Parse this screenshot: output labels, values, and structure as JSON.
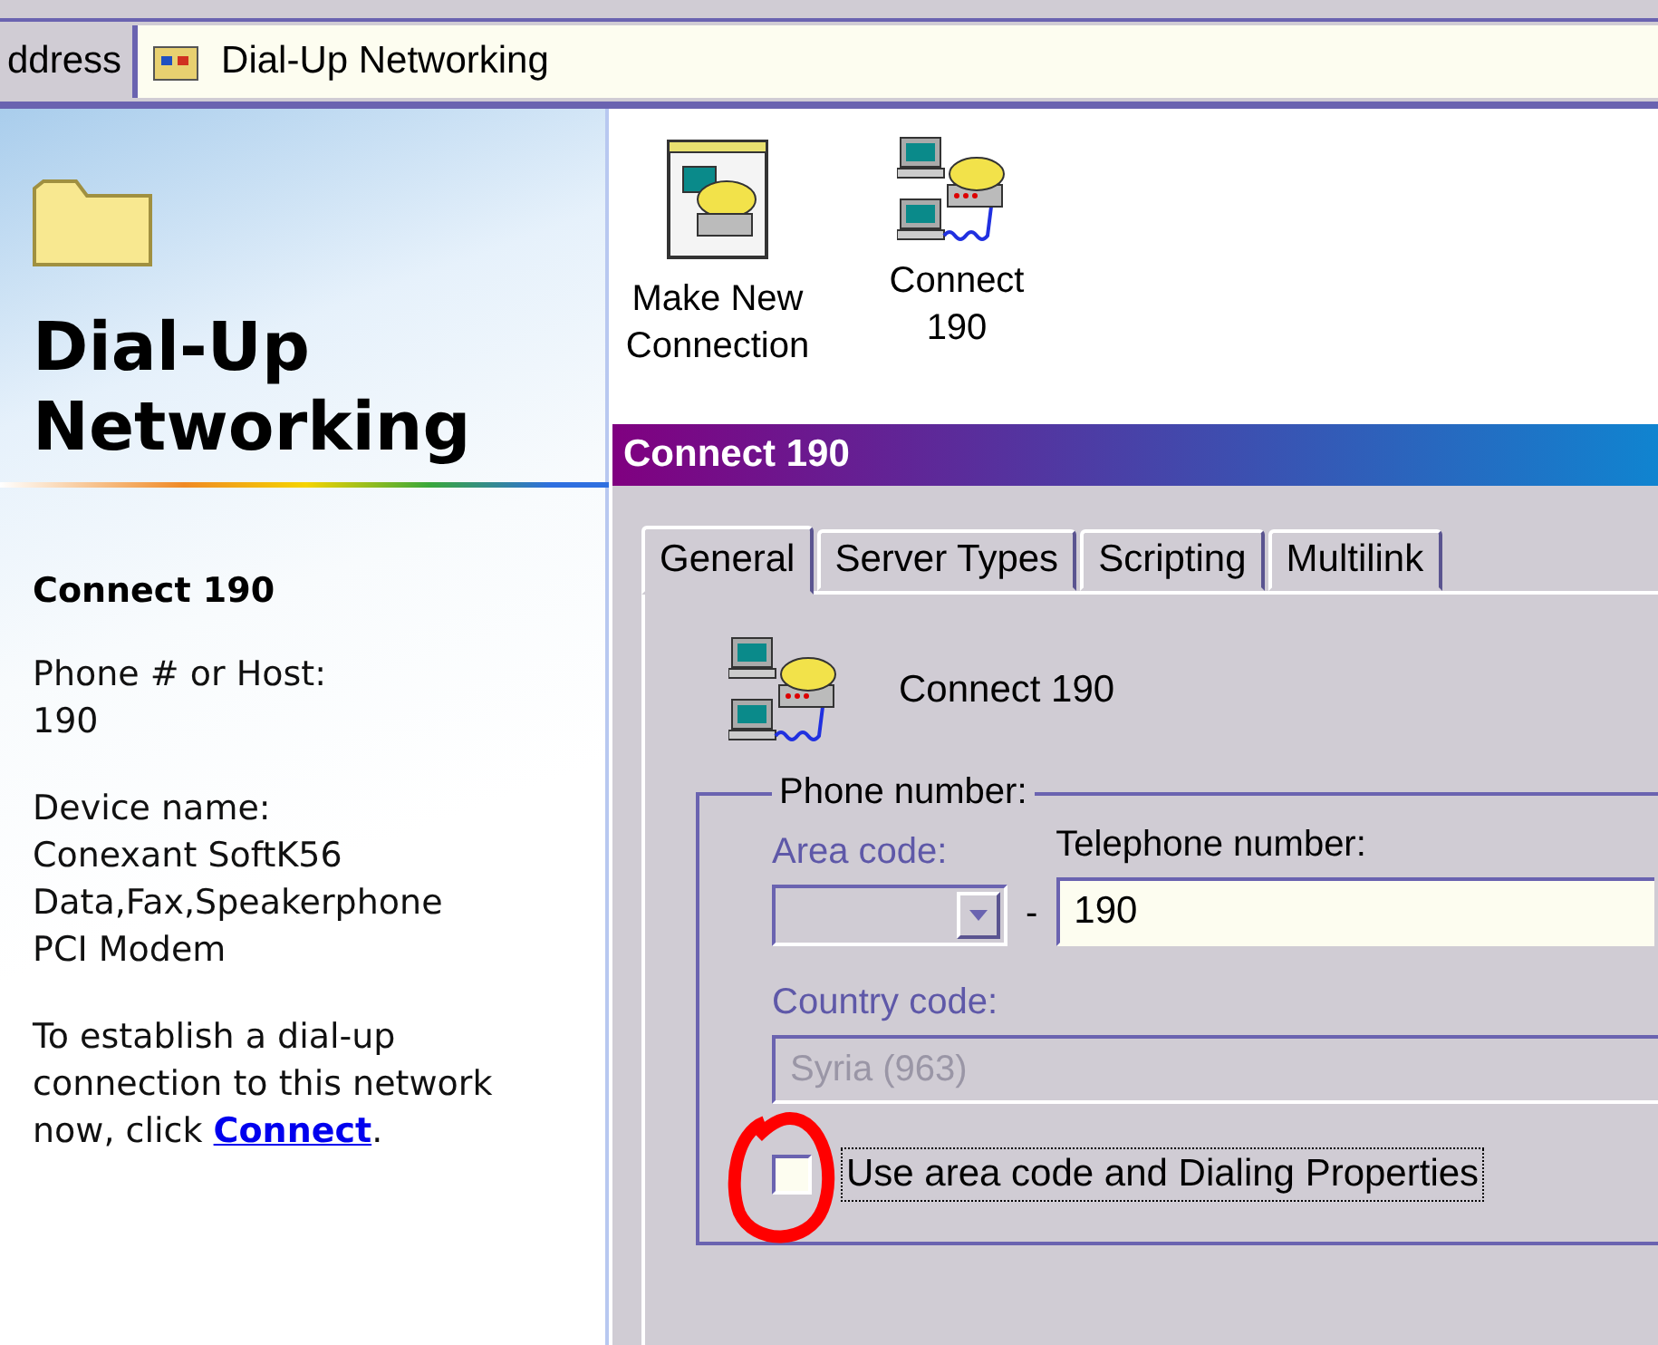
{
  "address_bar": {
    "label": "ddress",
    "value": "Dial-Up Networking"
  },
  "sidebar": {
    "title": "Dial-Up Networking",
    "connection_name": "Connect 190",
    "details": [
      {
        "label": "Phone # or Host:",
        "lines": [
          "190"
        ]
      },
      {
        "label": "Device name:",
        "lines": [
          "Conexant SoftK56",
          "Data,Fax,Speakerphone",
          "PCI Modem"
        ]
      }
    ],
    "instruction": "To establish a dial-up connection to this network now, click",
    "link": "Connect",
    "after_link": "."
  },
  "icons": [
    {
      "label": "Make New Connection",
      "kind": "wizard"
    },
    {
      "label": "Connect 190",
      "kind": "connection"
    }
  ],
  "dialog": {
    "title": "Connect 190",
    "tabs": [
      {
        "label": "General",
        "selected": true
      },
      {
        "label": "Server Types",
        "selected": false
      },
      {
        "label": "Scripting",
        "selected": false
      },
      {
        "label": "Multilink",
        "selected": false
      }
    ],
    "connection_name": "Connect 190",
    "phone_group": {
      "legend": "Phone number:",
      "area_code": {
        "label": "Area code:",
        "disabled": true
      },
      "separator": "-",
      "telephone": {
        "label": "Telephone number:",
        "value": "190"
      },
      "country_code": {
        "label": "Country code:",
        "value": "Syria (963)",
        "disabled": true
      },
      "checkbox": {
        "label": "Use area code and Dialing Properties",
        "checked": false,
        "focused": true,
        "circled": true
      }
    }
  }
}
